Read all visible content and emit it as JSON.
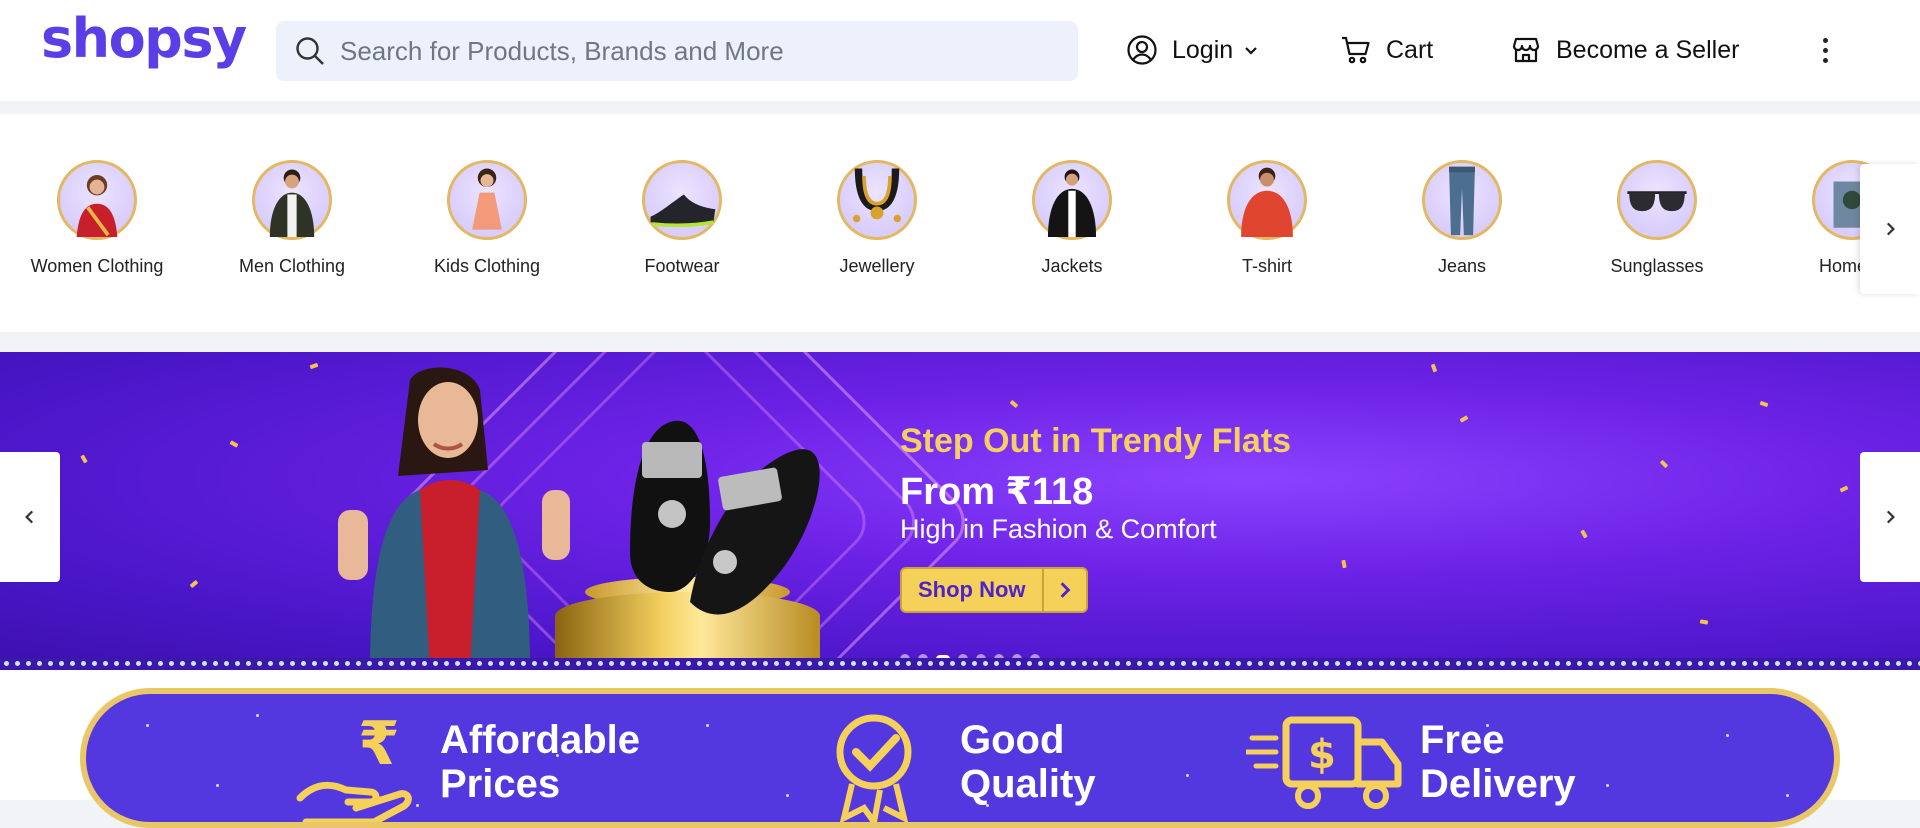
{
  "header": {
    "logo": "shopsy",
    "search_placeholder": "Search for Products, Brands and More",
    "login_label": "Login",
    "cart_label": "Cart",
    "seller_label": "Become a Seller"
  },
  "categories": [
    {
      "label": "Women Clothing"
    },
    {
      "label": "Men Clothing"
    },
    {
      "label": "Kids Clothing"
    },
    {
      "label": "Footwear"
    },
    {
      "label": "Jewellery"
    },
    {
      "label": "Jackets"
    },
    {
      "label": "T-shirt"
    },
    {
      "label": "Jeans"
    },
    {
      "label": "Sunglasses"
    },
    {
      "label": "Home D"
    }
  ],
  "banner": {
    "title": "Step Out in Trendy Flats",
    "price": "From ₹118",
    "subtitle": "High in Fashion & Comfort",
    "cta": "Shop Now",
    "slide_count": 8,
    "active_slide": 3
  },
  "features": [
    {
      "label": "Affordable Prices",
      "icon": "rupee-hand-icon"
    },
    {
      "label": "Good Quality",
      "icon": "quality-badge-icon"
    },
    {
      "label": "Free Delivery",
      "icon": "delivery-truck-icon"
    }
  ],
  "colors": {
    "brand": "#5b3ee6",
    "banner_accent": "#f6cf63",
    "features_bg": "#5338e0"
  }
}
